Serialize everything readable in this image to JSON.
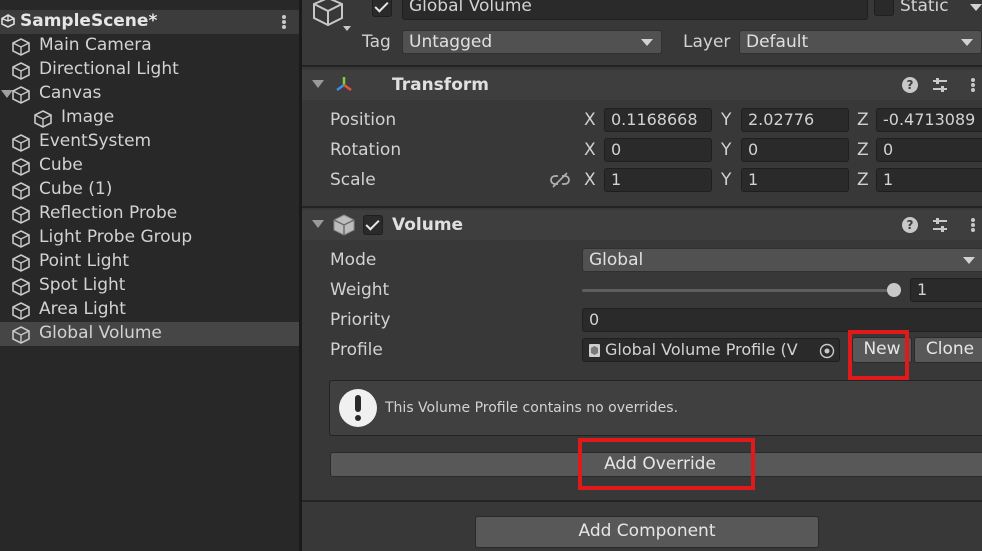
{
  "hierarchy": {
    "scene_name": "SampleScene*",
    "items": [
      {
        "label": "Main Camera"
      },
      {
        "label": "Directional Light"
      },
      {
        "label": "Canvas"
      },
      {
        "label": "Image"
      },
      {
        "label": "EventSystem"
      },
      {
        "label": "Cube"
      },
      {
        "label": "Cube (1)"
      },
      {
        "label": "Reflection Probe"
      },
      {
        "label": "Light Probe Group"
      },
      {
        "label": "Point Light"
      },
      {
        "label": "Spot Light"
      },
      {
        "label": "Area Light"
      },
      {
        "label": "Global Volume"
      }
    ],
    "selected": "Global Volume"
  },
  "inspector": {
    "object_name": "Global Volume",
    "static_label": "Static",
    "tag_label": "Tag",
    "tag_value": "Untagged",
    "layer_label": "Layer",
    "layer_value": "Default",
    "transform": {
      "title": "Transform",
      "position_label": "Position",
      "rotation_label": "Rotation",
      "scale_label": "Scale",
      "axis_x": "X",
      "axis_y": "Y",
      "axis_z": "Z",
      "position": {
        "x": "0.1168668",
        "y": "2.02776",
        "z": "-0.4713089"
      },
      "rotation": {
        "x": "0",
        "y": "0",
        "z": "0"
      },
      "scale": {
        "x": "1",
        "y": "1",
        "z": "1"
      }
    },
    "volume": {
      "title": "Volume",
      "mode_label": "Mode",
      "mode_value": "Global",
      "weight_label": "Weight",
      "weight_value": "1",
      "priority_label": "Priority",
      "priority_value": "0",
      "profile_label": "Profile",
      "profile_value": "Global Volume Profile (V",
      "new_button": "New",
      "clone_button": "Clone",
      "help_message": "This Volume Profile contains no overrides.",
      "add_override_button": "Add Override"
    },
    "add_component_button": "Add Component"
  },
  "colors": {
    "highlight": "#e0191b",
    "panel_bg": "#383838",
    "hierarchy_bg": "#282828"
  }
}
